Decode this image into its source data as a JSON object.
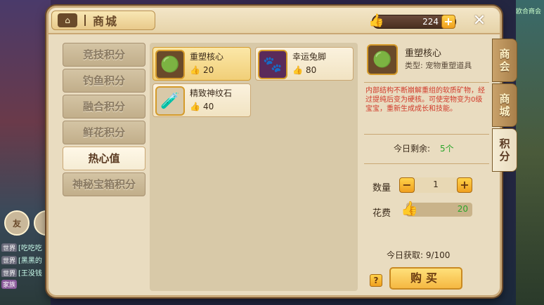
{
  "background": {
    "friend_label": "友",
    "chat": [
      {
        "tag": "世界",
        "text": "[吃吃吃"
      },
      {
        "tag": "世界",
        "text": "[黑黑的"
      },
      {
        "tag": "世界",
        "text": "[王没钱"
      },
      {
        "tag": "家族",
        "text": ""
      }
    ],
    "top_right_text": "欧合商会"
  },
  "header": {
    "title": "商城",
    "points_value": "224",
    "plus_label": "+",
    "close_label": "✕"
  },
  "categories": [
    {
      "label": "竞技积分"
    },
    {
      "label": "钓鱼积分"
    },
    {
      "label": "融合积分"
    },
    {
      "label": "鲜花积分"
    },
    {
      "label": "热心值"
    },
    {
      "label": "神秘宝箱积分"
    }
  ],
  "active_category_index": 4,
  "items": [
    {
      "name": "重塑核心",
      "price": "20",
      "icon": "green-orb-icon",
      "selected": true
    },
    {
      "name": "幸运兔脚",
      "price": "80",
      "icon": "rabbit-foot-icon",
      "selected": false
    },
    {
      "name": "精致神纹石",
      "price": "40",
      "icon": "purple-potion-icon",
      "selected": false
    }
  ],
  "details": {
    "name": "重塑核心",
    "type": "类型:  宠物重塑道具",
    "description": "内部结构不断崩解重组的软质矿物，经过提纯后变为硬核。可使宠物变为0级宝宝，重新生成成长和技能。",
    "today_remaining_label": "今日剩余:",
    "today_remaining_value": "5个",
    "quantity_label": "数量",
    "quantity_value": "1",
    "minus_label": "−",
    "plus_label": "+",
    "cost_label": "花费",
    "cost_value": "20",
    "today_obtained": "今日获取:  9/100",
    "help_label": "?",
    "buy_label": "购买"
  },
  "side_tabs": [
    {
      "label": "商会"
    },
    {
      "label": "商城"
    },
    {
      "label": "积分"
    }
  ],
  "colors": {
    "accent": "#f0a020",
    "price_icon": "#e94a3a",
    "positive": "#2aa52a",
    "description": "#d13a2a"
  }
}
